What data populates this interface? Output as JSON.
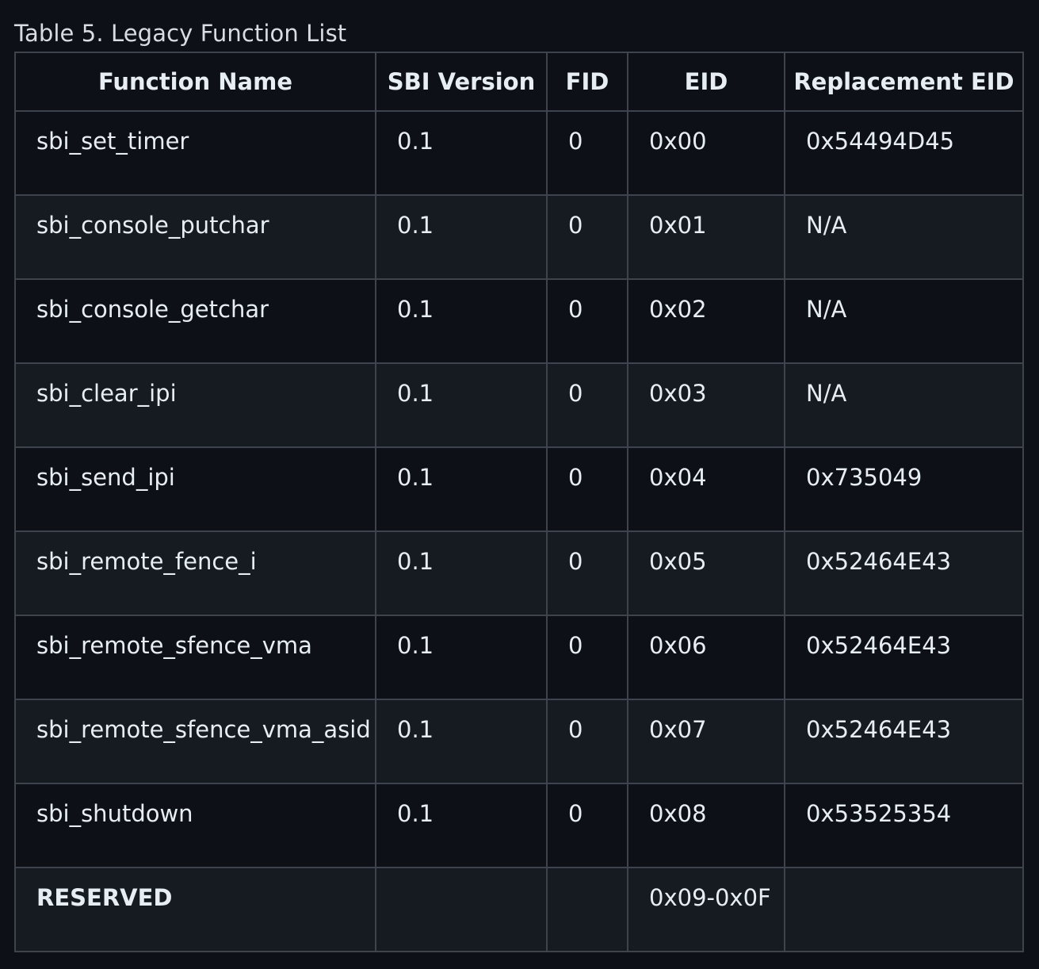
{
  "table": {
    "caption": "Table 5. Legacy Function List",
    "headers": [
      "Function Name",
      "SBI Version",
      "FID",
      "EID",
      "Replacement EID"
    ],
    "rows": [
      [
        "sbi_set_timer",
        "0.1",
        "0",
        "0x00",
        "0x54494D45"
      ],
      [
        "sbi_console_putchar",
        "0.1",
        "0",
        "0x01",
        "N/A"
      ],
      [
        "sbi_console_getchar",
        "0.1",
        "0",
        "0x02",
        "N/A"
      ],
      [
        "sbi_clear_ipi",
        "0.1",
        "0",
        "0x03",
        "N/A"
      ],
      [
        "sbi_send_ipi",
        "0.1",
        "0",
        "0x04",
        "0x735049"
      ],
      [
        "sbi_remote_fence_i",
        "0.1",
        "0",
        "0x05",
        "0x52464E43"
      ],
      [
        "sbi_remote_sfence_vma",
        "0.1",
        "0",
        "0x06",
        "0x52464E43"
      ],
      [
        "sbi_remote_sfence_vma_asid",
        "0.1",
        "0",
        "0x07",
        "0x52464E43"
      ],
      [
        "sbi_shutdown",
        "0.1",
        "0",
        "0x08",
        "0x53525354"
      ],
      [
        "RESERVED",
        "",
        "",
        "0x09-0x0F",
        ""
      ]
    ]
  }
}
